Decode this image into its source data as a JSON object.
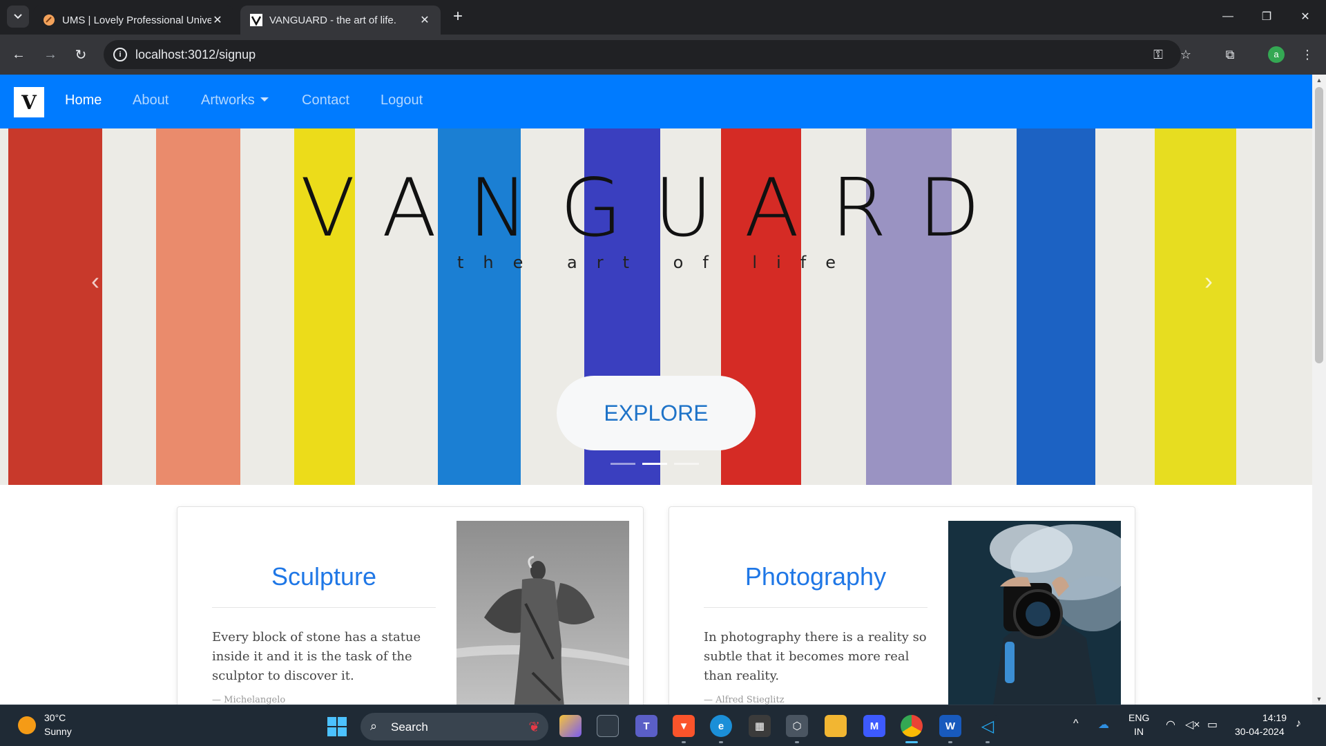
{
  "browser": {
    "tabs": [
      {
        "title": "UMS | Lovely Professional Unive",
        "active": false
      },
      {
        "title": "VANGUARD - the art of life.",
        "active": true
      }
    ],
    "url": "localhost:3012/signup",
    "profile_initial": "a"
  },
  "nav": {
    "logo": "V",
    "items": [
      "Home",
      "About",
      "Artworks",
      "Contact",
      "Logout"
    ]
  },
  "hero": {
    "title": "VANGUARD",
    "subtitle": "the art of life",
    "button": "EXPLORE",
    "prev_arrow": "‹",
    "next_arrow": "›",
    "slides": 3,
    "active_slide": 2,
    "stripe_colors": [
      "#c8392b",
      "#ea8b6c",
      "#ecdc1a",
      "#1b7fd3",
      "#3a3fbf",
      "#d52b25",
      "#9a93c2",
      "#1c62c3",
      "#e7dd20"
    ]
  },
  "cards": [
    {
      "title": "Sculpture",
      "text": "Every block of stone has a statue inside it and it is the task of the sculptor to discover it.",
      "author": "— Michelangelo"
    },
    {
      "title": "Photography",
      "text": "In photography there is a reality so subtle that it becomes more real than reality.",
      "author": "— Alfred Stieglitz"
    }
  ],
  "taskbar": {
    "temp": "30°C",
    "weather": "Sunny",
    "search": "Search",
    "lang1": "ENG",
    "lang2": "IN",
    "time": "14:19",
    "date": "30-04-2024"
  }
}
